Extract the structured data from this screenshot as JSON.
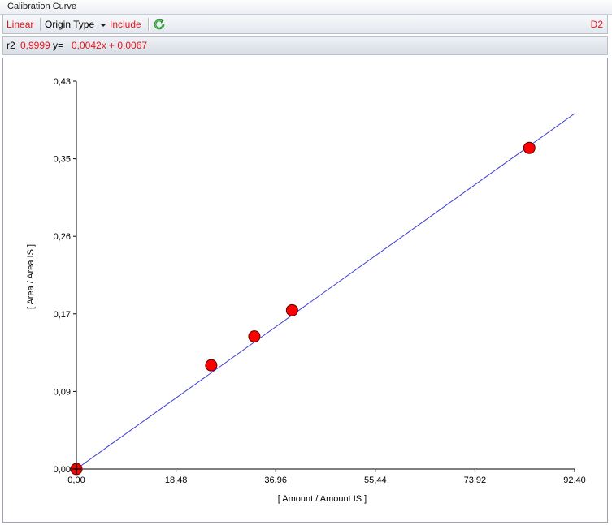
{
  "panel": {
    "title": "Calibration Curve"
  },
  "toolbar": {
    "fit_label": "Linear",
    "origin_label": "Origin Type",
    "include_label": "Include",
    "refresh_icon": "refresh-icon",
    "sample_label": "D2"
  },
  "stats": {
    "r2_label": "r2",
    "r2_value": "0,9999",
    "eq_label": "y=",
    "eq_value": "0,0042x + 0,0067"
  },
  "colors": {
    "accent_red": "#e8141c",
    "point_fill": "#ff0000",
    "fit_line": "#3a3ad6"
  },
  "chart_data": {
    "type": "scatter",
    "xlabel": "[ Amount / Amount IS ]",
    "ylabel": "[ Area / Area IS ]",
    "xlim": [
      0,
      92.4
    ],
    "ylim": [
      0,
      0.43
    ],
    "x_ticks": [
      "0,00",
      "18,48",
      "36,96",
      "55,44",
      "73,92",
      "92,40"
    ],
    "y_ticks": [
      "0,00",
      "0,09",
      "0,17",
      "0,26",
      "0,35",
      "0,43"
    ],
    "grid": false,
    "points": [
      {
        "x": 0.0,
        "y": 0.0
      },
      {
        "x": 25.0,
        "y": 0.115
      },
      {
        "x": 33.0,
        "y": 0.147
      },
      {
        "x": 40.0,
        "y": 0.176
      },
      {
        "x": 84.0,
        "y": 0.356
      }
    ],
    "fit_line": {
      "x_start": 0.0,
      "y_start": 0.0,
      "x_end": 92.4,
      "y_end": 0.394
    },
    "origin_marker": {
      "x": 0.0,
      "y": 0.0,
      "symbol": "plus"
    }
  }
}
